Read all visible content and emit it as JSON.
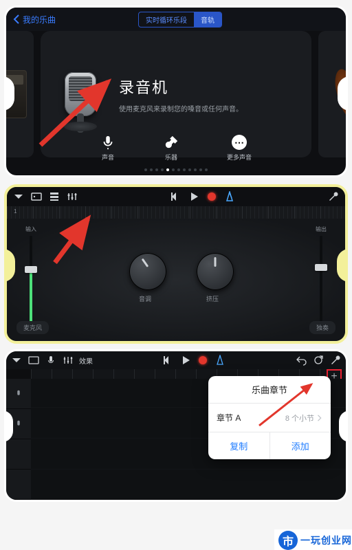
{
  "panel1": {
    "back_label": "我的乐曲",
    "seg_left": "实时循环乐段",
    "seg_right": "音轨",
    "title": "录音机",
    "subtitle": "使用麦克风来录制您的嗓音或任何声音。",
    "icon_voice": "声音",
    "icon_instr": "乐器",
    "icon_more": "更多声音"
  },
  "panel2": {
    "ruler_start": "1",
    "in_label": "输入",
    "out_label": "输出",
    "knob1_label": "音调",
    "knob2_label": "挤压",
    "pill_left": "麦克风",
    "pill_right": "独奏"
  },
  "panel3": {
    "fx_label": "效果",
    "plus": "+",
    "pop_title": "乐曲章节",
    "pop_section": "章节 A",
    "pop_value": "8 个小节",
    "pop_copy": "复制",
    "pop_add": "添加"
  },
  "watermark": {
    "glyph": "市",
    "text": "一玩创业网"
  }
}
